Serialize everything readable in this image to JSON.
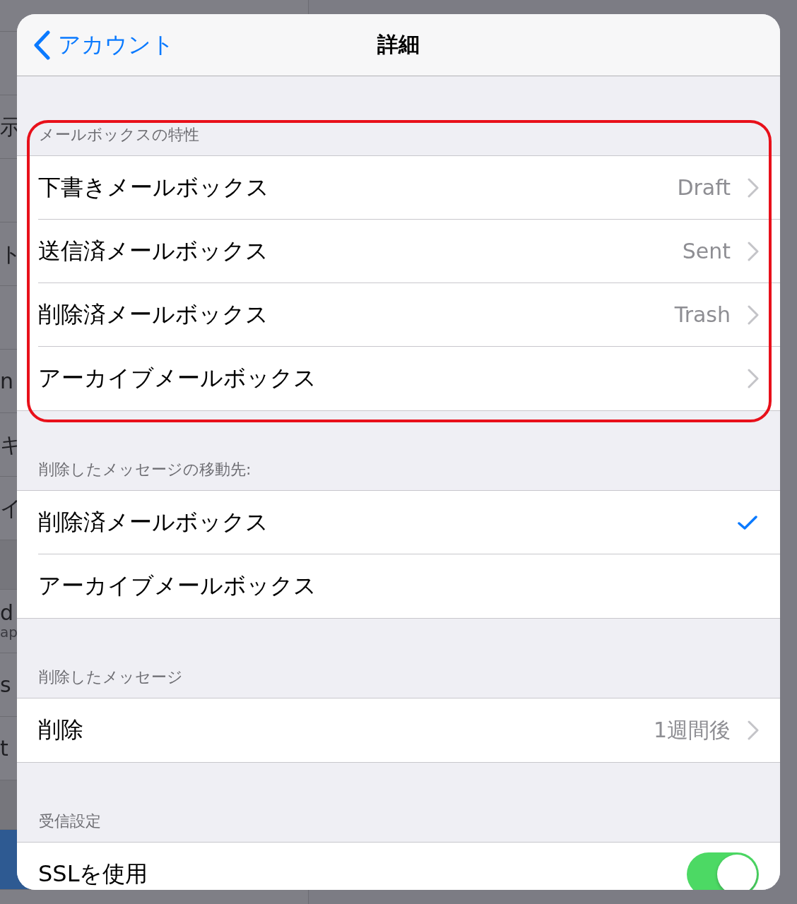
{
  "background_list": {
    "items": [
      {
        "kind": "partial"
      },
      {
        "kind": "row",
        "selected": false
      },
      {
        "kind": "row",
        "text": "示",
        "selected": false
      },
      {
        "kind": "row",
        "selected": false
      },
      {
        "kind": "row",
        "text": "ト",
        "selected": false
      },
      {
        "kind": "row",
        "selected": false
      },
      {
        "kind": "row",
        "text": "n",
        "selected": false
      },
      {
        "kind": "row",
        "text": "キ",
        "selected": false
      },
      {
        "kind": "row",
        "text": "イ",
        "selected": false
      },
      {
        "kind": "gap"
      },
      {
        "kind": "row",
        "text": "d",
        "subtext": "ap",
        "selected": false
      },
      {
        "kind": "row",
        "text": "s",
        "selected": false
      },
      {
        "kind": "row",
        "text": "t",
        "selected": false
      },
      {
        "kind": "gap"
      },
      {
        "kind": "row",
        "selected": true
      }
    ]
  },
  "dialog": {
    "back_button": "アカウント",
    "title": "詳細",
    "sections": [
      {
        "header": "メールボックスの特性",
        "highlighted": true,
        "rows": [
          {
            "kind": "disclosure",
            "label": "下書きメールボックス",
            "value": "Draft"
          },
          {
            "kind": "disclosure",
            "label": "送信済メールボックス",
            "value": "Sent"
          },
          {
            "kind": "disclosure",
            "label": "削除済メールボックス",
            "value": "Trash"
          },
          {
            "kind": "disclosure",
            "label": "アーカイブメールボックス"
          }
        ]
      },
      {
        "header": "削除したメッセージの移動先:",
        "highlighted": false,
        "rows": [
          {
            "kind": "choice",
            "label": "削除済メールボックス",
            "selected": true
          },
          {
            "kind": "choice",
            "label": "アーカイブメールボックス",
            "selected": false
          }
        ]
      },
      {
        "header": "削除したメッセージ",
        "highlighted": false,
        "rows": [
          {
            "kind": "disclosure",
            "label": "削除",
            "value": "1週間後"
          }
        ]
      },
      {
        "header": "受信設定",
        "highlighted": false,
        "rows": [
          {
            "kind": "toggle",
            "label": "SSLを使用",
            "on": true
          }
        ]
      }
    ]
  }
}
